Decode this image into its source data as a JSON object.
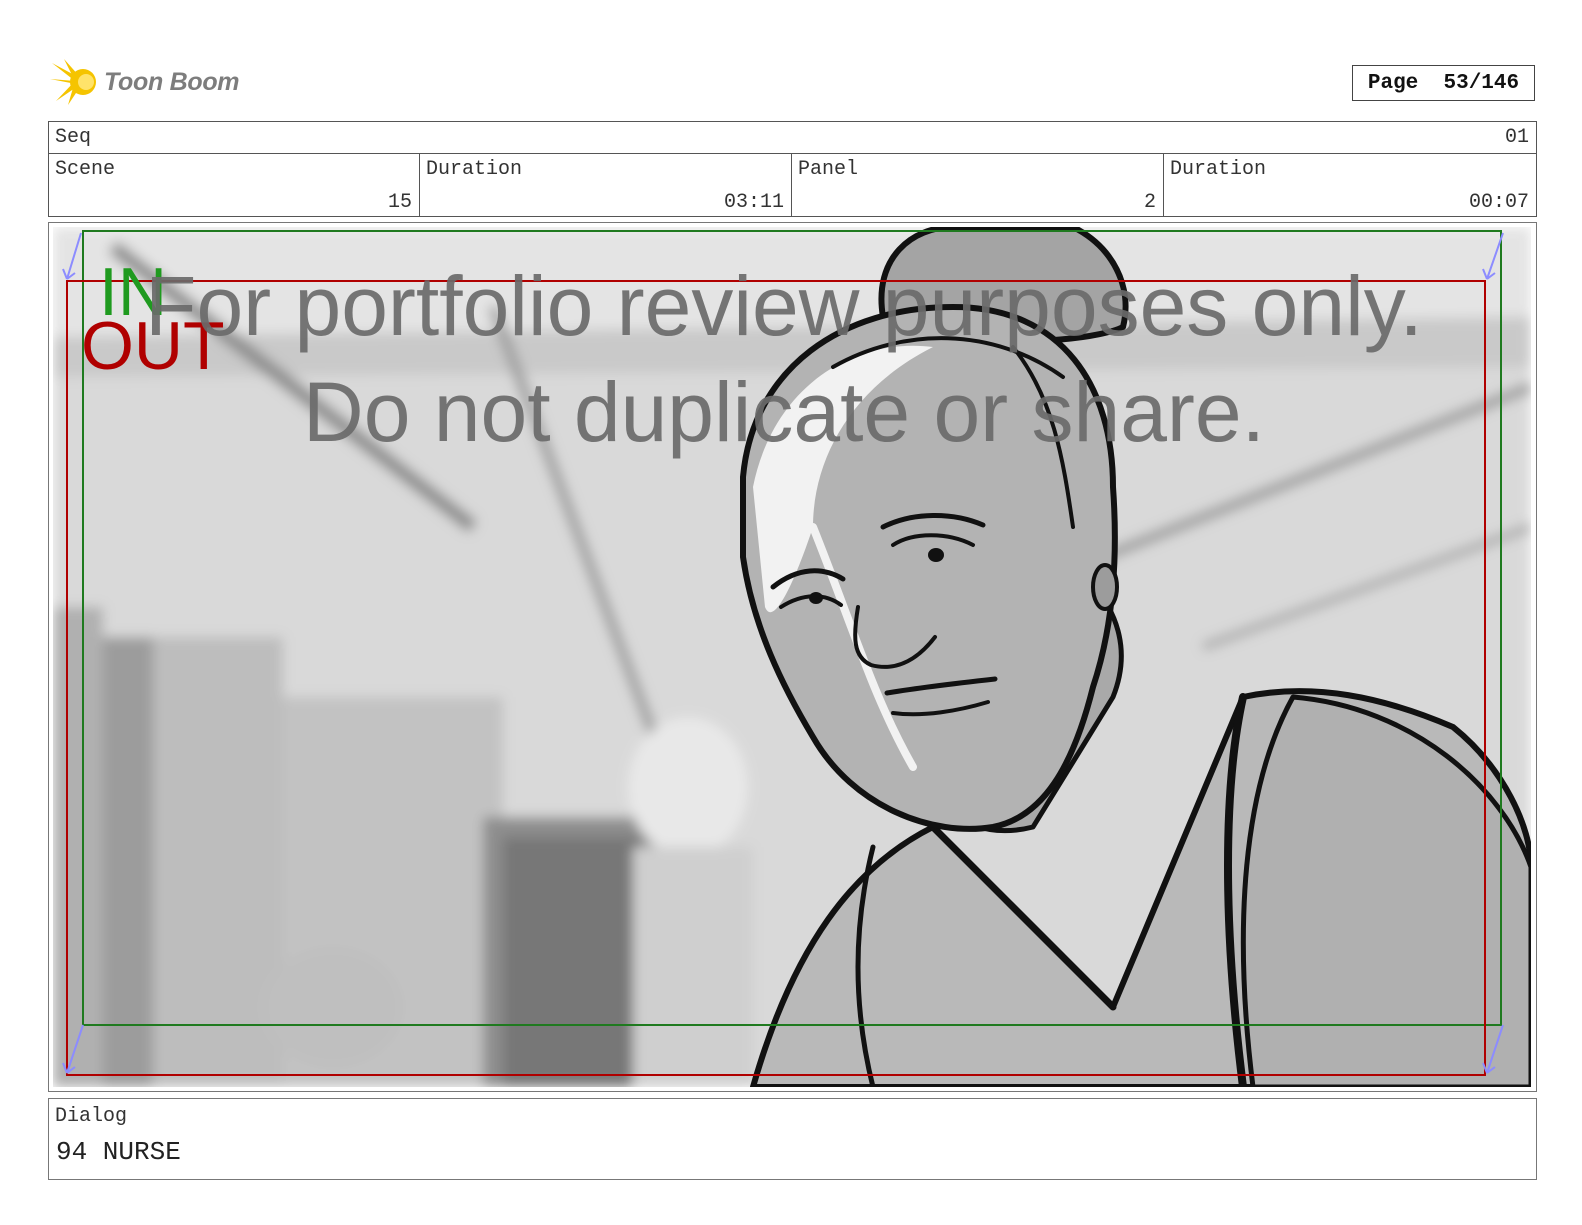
{
  "brand": {
    "name": "Toon Boom",
    "accent": "#f5c400"
  },
  "page": {
    "label": "Page",
    "current": 53,
    "total": 146,
    "display": "Page  53/146"
  },
  "sequence": {
    "label": "Seq",
    "value": "01"
  },
  "header_cells": [
    {
      "label": "Scene",
      "value": "15"
    },
    {
      "label": "Duration",
      "value": "03:11"
    },
    {
      "label": "Panel",
      "value": "2"
    },
    {
      "label": "Duration",
      "value": "00:07"
    }
  ],
  "panel": {
    "in_marker": "IN",
    "out_marker": "OUT",
    "watermark_line1": "For portfolio review purposes only.",
    "watermark_line2": "Do not duplicate or share.",
    "colors": {
      "in": "#1f9a1f",
      "out": "#b00000",
      "watermark": "#6a6a6a"
    }
  },
  "dialog": {
    "label": "Dialog",
    "text": "94 NURSE"
  }
}
